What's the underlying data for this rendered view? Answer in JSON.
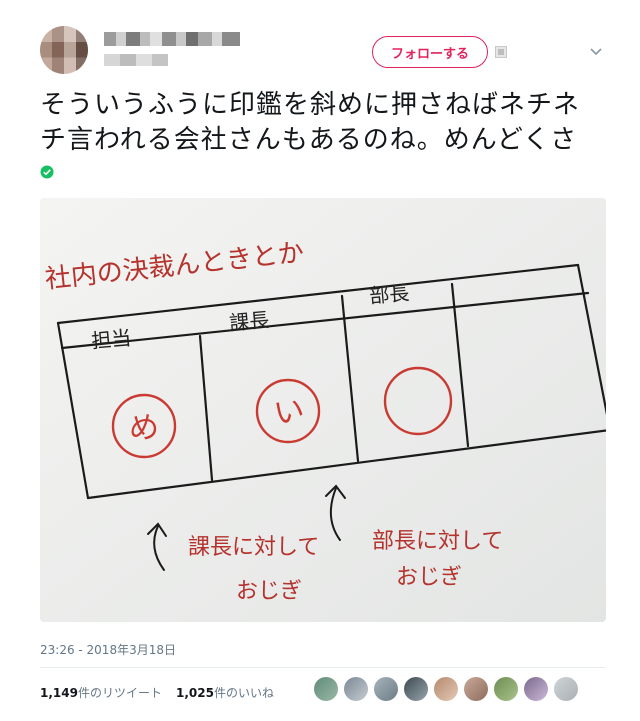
{
  "header": {
    "follow_label": "フォローする"
  },
  "tweet": {
    "text_line1": "そういうふうに印鑑を斜めに押さねばネチネ",
    "text_line2": "チ言われる会社さんもあるのね。めんどくさ",
    "timestamp": "23:26 - 2018年3月18日"
  },
  "photo": {
    "title": "社内の決裁んときとか",
    "headers": [
      "担当",
      "課長",
      "部長",
      ""
    ],
    "stamps": [
      "め",
      "い",
      ""
    ],
    "annotation_left_1": "課長に対して",
    "annotation_left_2": "おじぎ",
    "annotation_right_1": "部長に対して",
    "annotation_right_2": "おじぎ"
  },
  "stats": {
    "retweets_count": "1,149",
    "retweets_label": "件のリツイート",
    "likes_count": "1,025",
    "likes_label": "件のいいね"
  },
  "icons": {
    "verified": "check-circle-icon",
    "caret": "chevron-down-icon",
    "block": "image-icon"
  },
  "colors": {
    "accent": "#e0245e",
    "verified": "#17bf63",
    "ink_red": "#c93a32",
    "meta": "#657786"
  }
}
